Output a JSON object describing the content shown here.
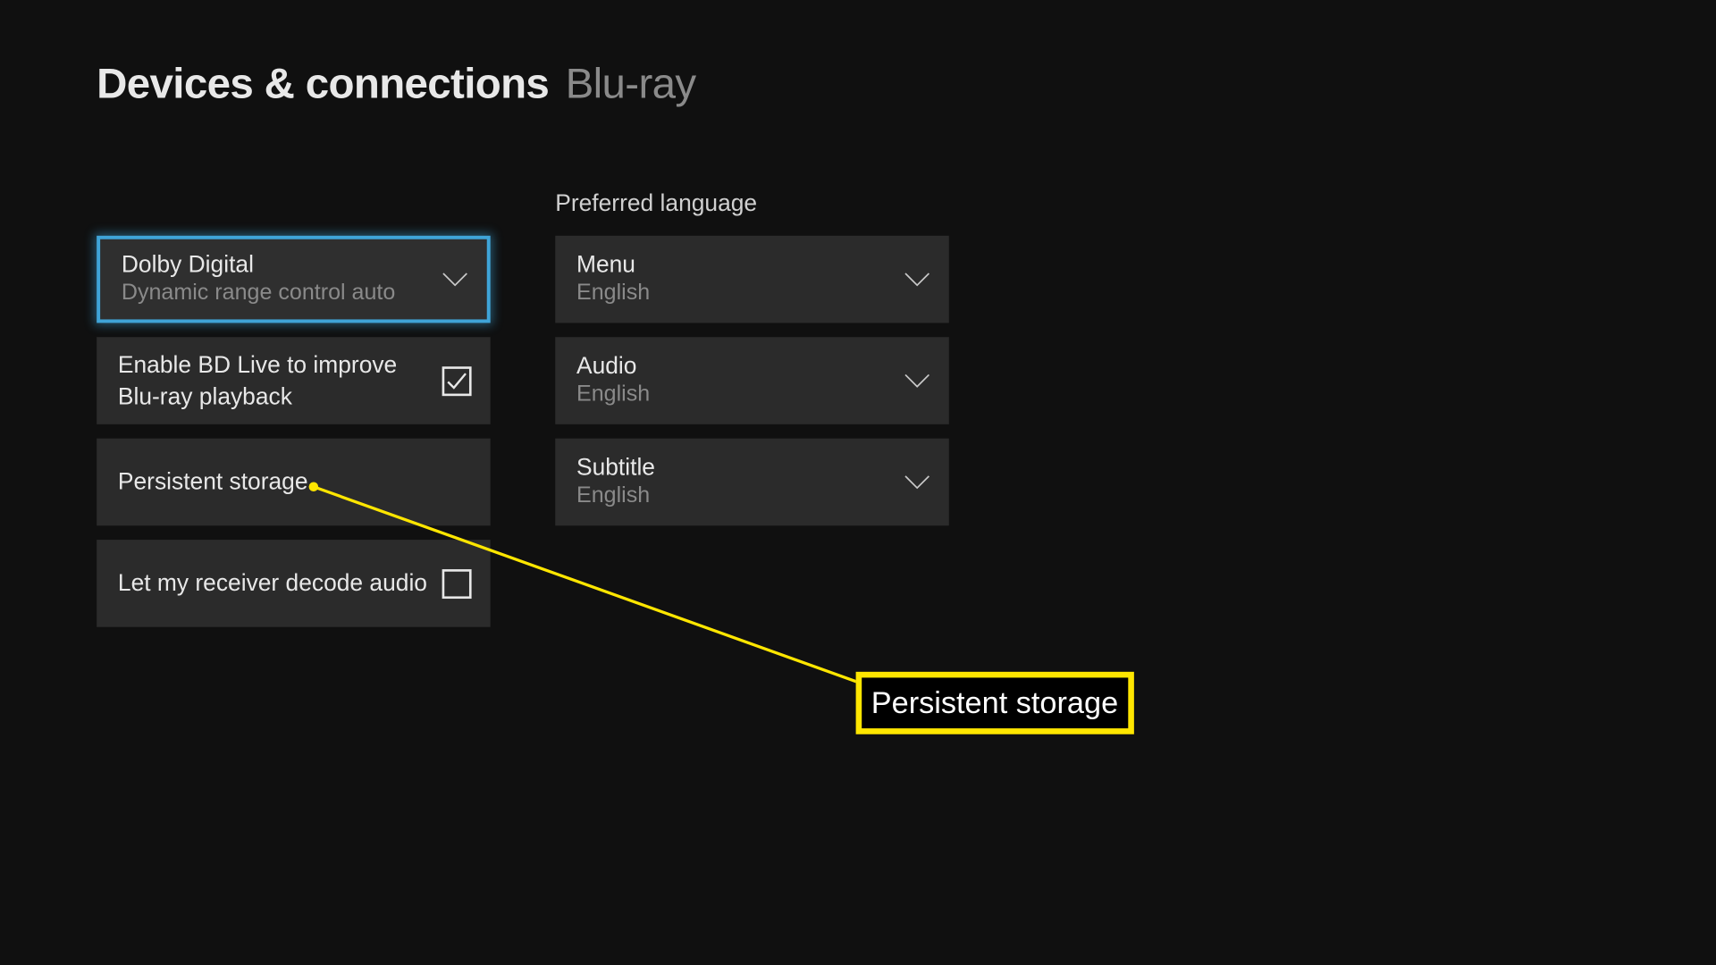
{
  "header": {
    "breadcrumb": "Devices & connections",
    "page": "Blu-ray"
  },
  "left": {
    "dolby": {
      "primary": "Dolby Digital",
      "secondary": "Dynamic range control auto"
    },
    "bdlive": {
      "primary_line1": "Enable BD Live to improve",
      "primary_line2": "Blu-ray playback",
      "checked": true
    },
    "persistent": {
      "primary": "Persistent storage"
    },
    "receiver": {
      "primary": "Let my receiver decode audio",
      "checked": false
    }
  },
  "right": {
    "section_title": "Preferred language",
    "menu": {
      "primary": "Menu",
      "secondary": "English"
    },
    "audio": {
      "primary": "Audio",
      "secondary": "English"
    },
    "subtitle": {
      "primary": "Subtitle",
      "secondary": "English"
    }
  },
  "annotation": {
    "label": "Persistent storage"
  },
  "colors": {
    "focus": "#3fa4d8",
    "annotation": "#ffe600"
  }
}
